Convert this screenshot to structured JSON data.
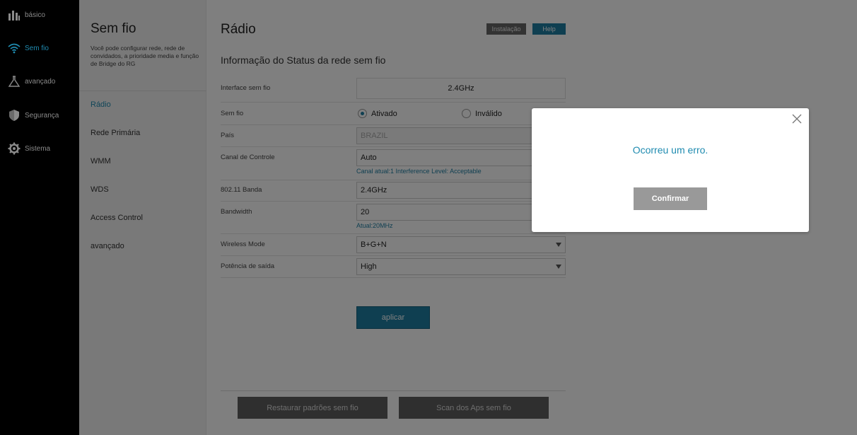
{
  "nav": {
    "items": [
      {
        "label": "básico",
        "icon": "bar-chart-icon"
      },
      {
        "label": "Sem fio",
        "icon": "wifi-icon",
        "active": true
      },
      {
        "label": "avançado",
        "icon": "flask-icon"
      },
      {
        "label": "Segurança",
        "icon": "shield-icon"
      },
      {
        "label": "Sistema",
        "icon": "gear-icon"
      }
    ]
  },
  "submenu": {
    "title": "Sem fio",
    "description": "Você pode configurar rede, rede de convidados, a prioridade media e função de Bridge do RG",
    "items": [
      {
        "label": "Rádio",
        "active": true
      },
      {
        "label": "Rede Primária"
      },
      {
        "label": "WMM"
      },
      {
        "label": "WDS"
      },
      {
        "label": "Access Control"
      },
      {
        "label": "avançado"
      }
    ]
  },
  "main": {
    "title": "Rádio",
    "install_label": "Instalação",
    "help_label": "Help",
    "section_title": "Informação do Status da rede sem fio",
    "rows": {
      "interface": {
        "label": "Interface sem fio",
        "value": "2.4GHz"
      },
      "wireless": {
        "label": "Sem fio",
        "on_label": "Ativado",
        "off_label": "Inválido",
        "selected": "Ativado"
      },
      "country": {
        "label": "País",
        "value": "BRAZIL"
      },
      "channel": {
        "label": "Canal de Controle",
        "value": "Auto",
        "hint": "Canal atual:1 Interference Level: Acceptable"
      },
      "band": {
        "label": "802.11 Banda",
        "value": "2.4GHz"
      },
      "bandwidth": {
        "label": "Bandwidth",
        "value": "20",
        "hint": "Atual:20MHz"
      },
      "mode": {
        "label": "Wireless Mode",
        "value": "B+G+N"
      },
      "power": {
        "label": "Potência de saída",
        "value": "High"
      }
    },
    "apply_label": "aplicar",
    "restore_label": "Restaurar padrões sem fio",
    "scan_label": "Scan dos Aps sem fio"
  },
  "modal": {
    "message": "Ocorreu um erro.",
    "confirm_label": "Confirmar"
  },
  "colors": {
    "accent": "#1f8bb0",
    "nav_bg": "#000000",
    "overlay": "rgba(0,0,0,0.5)"
  }
}
